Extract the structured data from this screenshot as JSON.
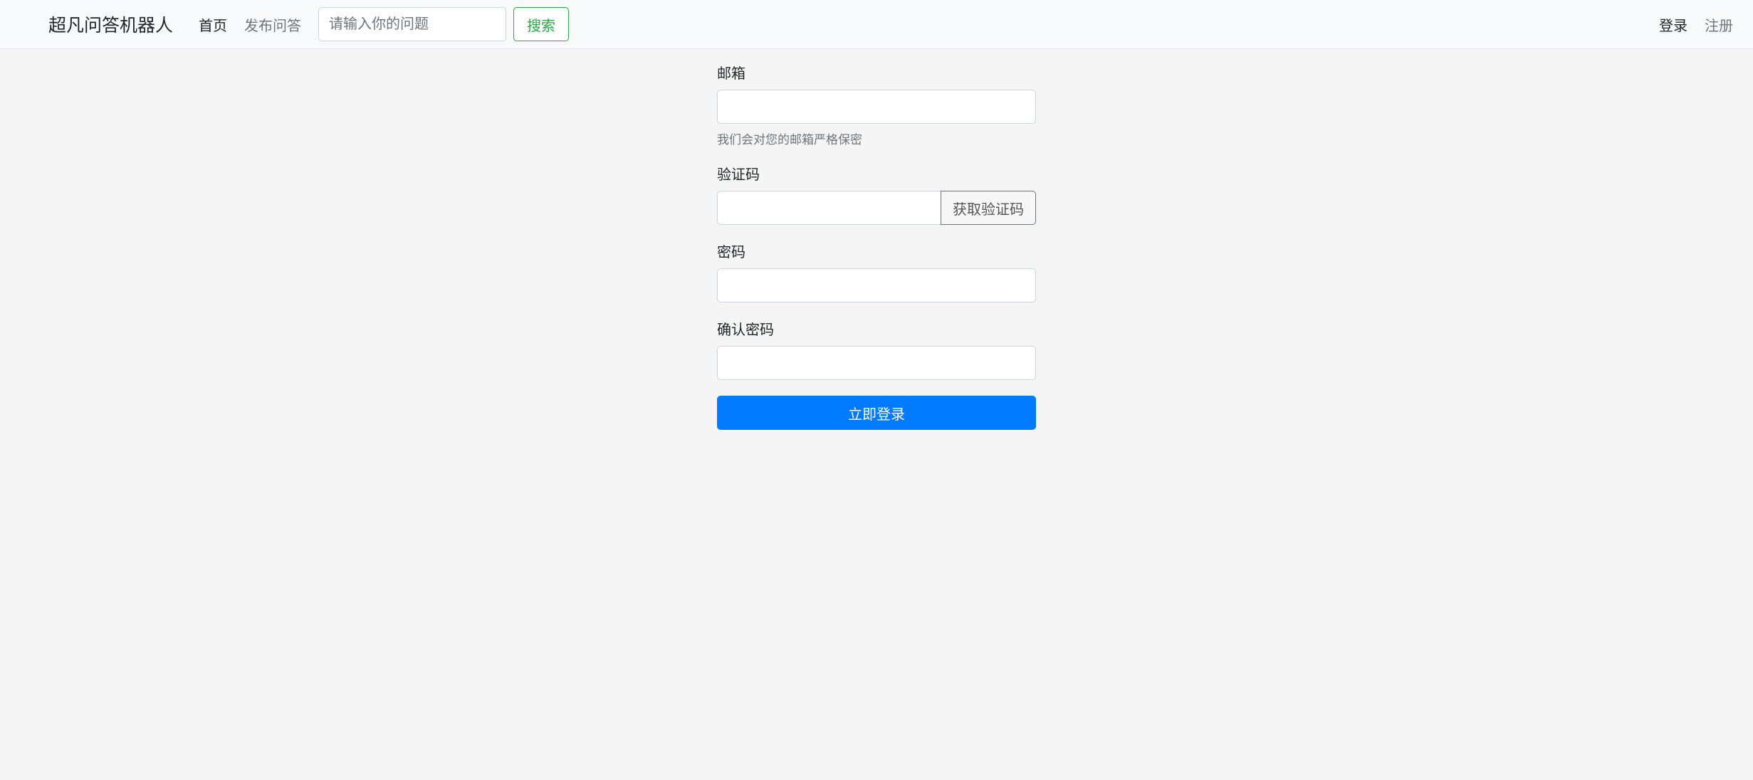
{
  "navbar": {
    "brand": "超凡问答机器人",
    "links": {
      "home": "首页",
      "post": "发布问答"
    },
    "search": {
      "placeholder": "请输入你的问题",
      "button": "搜索"
    },
    "right": {
      "login": "登录",
      "register": "注册"
    }
  },
  "form": {
    "email": {
      "label": "邮箱",
      "help": "我们会对您的邮箱严格保密"
    },
    "captcha": {
      "label": "验证码",
      "button": "获取验证码"
    },
    "password": {
      "label": "密码"
    },
    "confirmPassword": {
      "label": "确认密码"
    },
    "submit": "立即登录"
  }
}
